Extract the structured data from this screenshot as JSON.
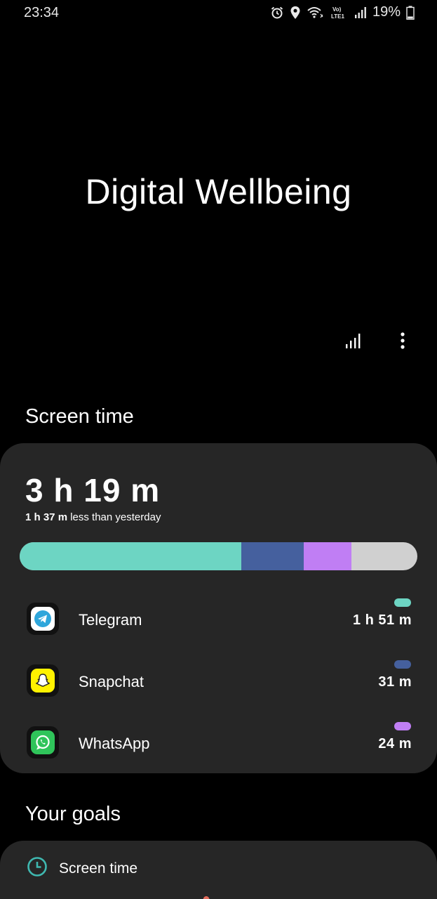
{
  "status_bar": {
    "time": "23:34",
    "network_label": "Vo) LTE1",
    "battery_percent": "19%",
    "icons": [
      "alarm-icon",
      "location-icon",
      "wifi-icon",
      "volte-icon",
      "signal-icon",
      "battery-icon"
    ]
  },
  "header": {
    "title": "Digital Wellbeing",
    "actions": [
      "bar-chart-icon",
      "more-vert-icon"
    ]
  },
  "screen_time": {
    "section_title": "Screen time",
    "total": "3 h 19 m",
    "compare_amount": "1 h 37 m",
    "compare_text": "less than yesterday",
    "bar_remainder_color": "#d0d0d0",
    "apps": [
      {
        "name": "Telegram",
        "time": "1 h 51 m",
        "color": "#6dd5c3",
        "share": 0.558,
        "icon": "telegram-icon"
      },
      {
        "name": "Snapchat",
        "time": "31 m",
        "color": "#45609e",
        "share": 0.156,
        "icon": "snapchat-icon"
      },
      {
        "name": "WhatsApp",
        "time": "24 m",
        "color": "#c07ef4",
        "share": 0.121,
        "icon": "whatsapp-icon"
      }
    ]
  },
  "goals": {
    "section_title": "Your goals",
    "items": [
      {
        "label": "Screen time",
        "icon": "clock-icon"
      }
    ]
  }
}
